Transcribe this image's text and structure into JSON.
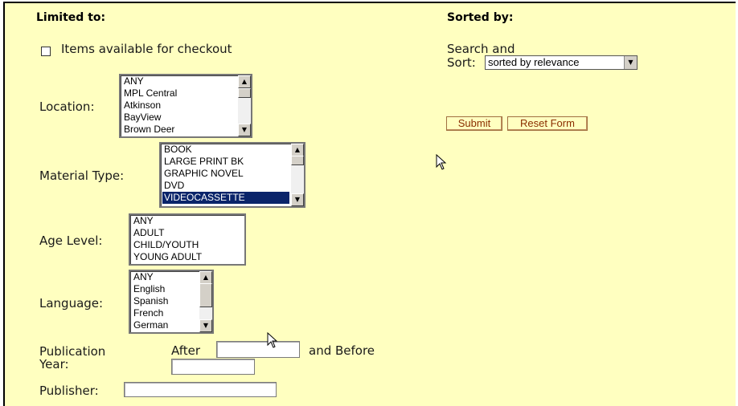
{
  "limited": {
    "heading": "Limited to:",
    "checkout_label": "Items available for checkout",
    "location": {
      "label": "Location:",
      "options": [
        "ANY",
        "MPL Central",
        "Atkinson",
        "BayView",
        "Brown Deer"
      ]
    },
    "material": {
      "label": "Material Type:",
      "options": [
        "BOOK",
        "LARGE PRINT BK",
        "GRAPHIC NOVEL",
        "DVD",
        "VIDEOCASSETTE"
      ],
      "selected": "VIDEOCASSETTE"
    },
    "age": {
      "label": "Age Level:",
      "options": [
        "ANY",
        "ADULT",
        "CHILD/YOUTH",
        "YOUNG ADULT"
      ]
    },
    "language": {
      "label": "Language:",
      "options": [
        "ANY",
        "English",
        "Spanish",
        "French",
        "German"
      ]
    },
    "pubyear": {
      "label_line1": "Publication",
      "label_line2": "Year:",
      "after": "After",
      "before": "and Before"
    },
    "publisher": {
      "label": "Publisher:"
    }
  },
  "sorted": {
    "heading": "Sorted by:",
    "line1": "Search and",
    "line2": "Sort:",
    "value": "sorted by relevance"
  },
  "buttons": {
    "submit": "Submit",
    "reset": "Reset Form"
  },
  "icons": {
    "checkbox": "checkbox-icon",
    "cursor": "mouse-pointer-icon"
  }
}
